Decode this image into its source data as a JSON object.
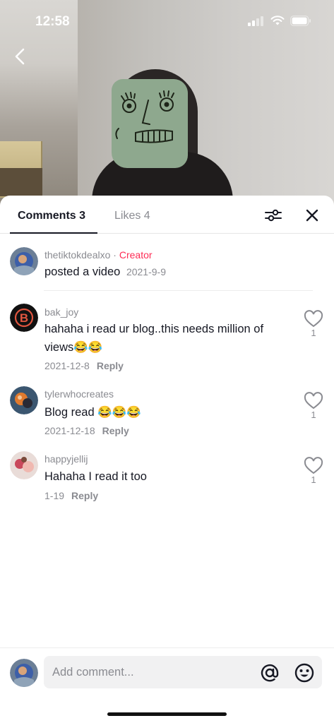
{
  "status_bar": {
    "time": "12:58"
  },
  "tabs": {
    "comments": "Comments 3",
    "likes": "Likes 4"
  },
  "creator_post": {
    "username": "thetiktokdealxo",
    "separator": "·",
    "badge": "Creator",
    "text": "posted a video",
    "date": "2021-9-9"
  },
  "comments": [
    {
      "username": "bak_joy",
      "text_line1": "hahaha i read ur blog..this needs million of",
      "text_line2": "views😂😂",
      "date": "2021-12-8",
      "reply": "Reply",
      "likes": "1"
    },
    {
      "username": "tylerwhocreates",
      "text_line1": "Blog read 😂😂😂",
      "date": "2021-12-18",
      "reply": "Reply",
      "likes": "1"
    },
    {
      "username": "happyjellij",
      "text_line1": "Hahaha I read it too",
      "date": "1-19",
      "reply": "Reply",
      "likes": "1"
    }
  ],
  "input": {
    "placeholder": "Add comment..."
  },
  "icons": {
    "back": "chevron-left-icon",
    "filter": "sliders-icon",
    "close": "close-icon",
    "heart": "heart-outline-icon",
    "mention": "at-icon",
    "emoji": "smiley-icon"
  },
  "colors": {
    "accent": "#fe2c55",
    "text": "#161823",
    "muted": "#8a8b91"
  }
}
